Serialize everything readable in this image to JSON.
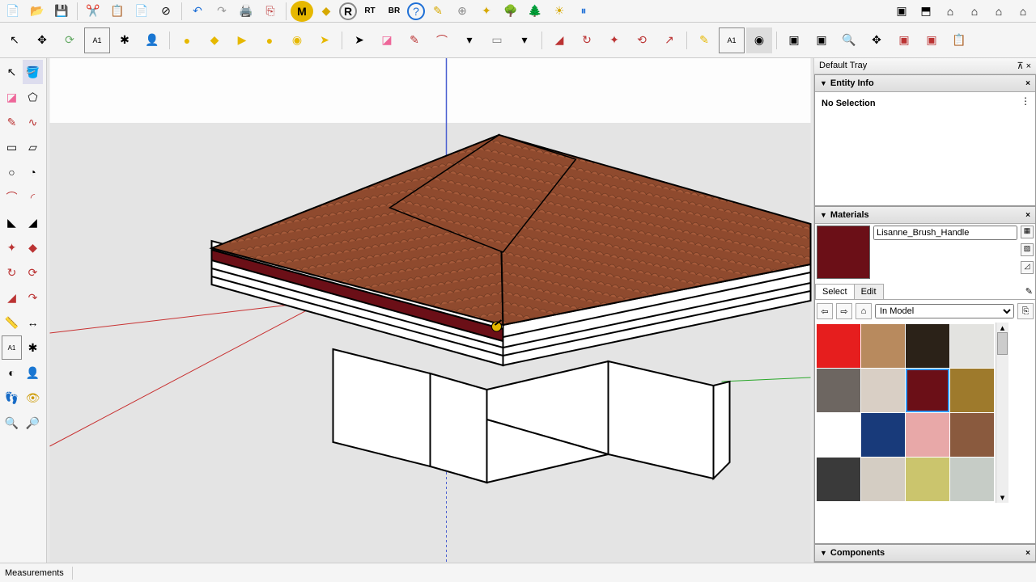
{
  "toolbar1": {
    "icons": [
      "new",
      "open",
      "save",
      "cut",
      "copy",
      "paste",
      "delete",
      "undo",
      "redo",
      "print",
      "export",
      "M",
      "yellow",
      "R",
      "RT",
      "BR",
      "help",
      "script",
      "globe",
      "layers",
      "trees",
      "tree2",
      "sun",
      "pause"
    ],
    "right_icons": [
      "iso",
      "top",
      "front",
      "back",
      "left",
      "right"
    ]
  },
  "toolbar2": {
    "icons": [
      "select",
      "move",
      "offset",
      "text",
      "axes",
      "person",
      "circle-y",
      "plane-y",
      "push-y",
      "sphere-y",
      "bulb-y",
      "ptr",
      "brush",
      "pencil",
      "arc",
      "arc2",
      "rect",
      "rect2",
      "fill",
      "rotate",
      "flip",
      "sync",
      "export2",
      "lock",
      "text2",
      "highlight",
      "comp1",
      "comp2",
      "zoom",
      "extents",
      "comp3",
      "comp4",
      "report"
    ]
  },
  "left_tools": {
    "icons": [
      "arrow",
      "bucket",
      "eraser",
      "poly",
      "pencil",
      "curve",
      "rect",
      "rect2",
      "circle",
      "pie",
      "arc",
      "arc2",
      "wedge",
      "wedge2",
      "push",
      "follow",
      "offset",
      "offset2",
      "move",
      "rotate",
      "scale",
      "scale2",
      "tape",
      "dim",
      "tag",
      "axes2",
      "protractor",
      "section",
      "walk",
      "look",
      "zoom2",
      "extents2"
    ]
  },
  "tray": {
    "title": "Default Tray",
    "pin": "⊼",
    "close": "×"
  },
  "entity": {
    "title": "Entity Info",
    "noselection": "No Selection"
  },
  "materials": {
    "title": "Materials",
    "current_name": "Lisanne_Brush_Handle",
    "tab_select": "Select",
    "tab_edit": "Edit",
    "dropdown": "In Model",
    "swatches": [
      {
        "color": "#e61e1e"
      },
      {
        "color": "#b88a5e"
      },
      {
        "color": "#2b2218"
      },
      {
        "color": "#e3e3e0"
      },
      {
        "color": "#6d6661"
      },
      {
        "color": "#d9cfc5"
      },
      {
        "color": "#6b0f17",
        "selected": true
      },
      {
        "color": "#9e7a2c"
      },
      {
        "color": "#ffffff"
      },
      {
        "color": "#183a7a"
      },
      {
        "color": "#e8a8a8"
      },
      {
        "color": "#8a5a3e"
      },
      {
        "color": "#3a3a3a"
      },
      {
        "color": "#d4cdc3"
      },
      {
        "color": "#cbc56d"
      },
      {
        "color": "#c6ccc6"
      }
    ]
  },
  "components": {
    "title": "Components"
  },
  "status": {
    "label": "Measurements"
  }
}
